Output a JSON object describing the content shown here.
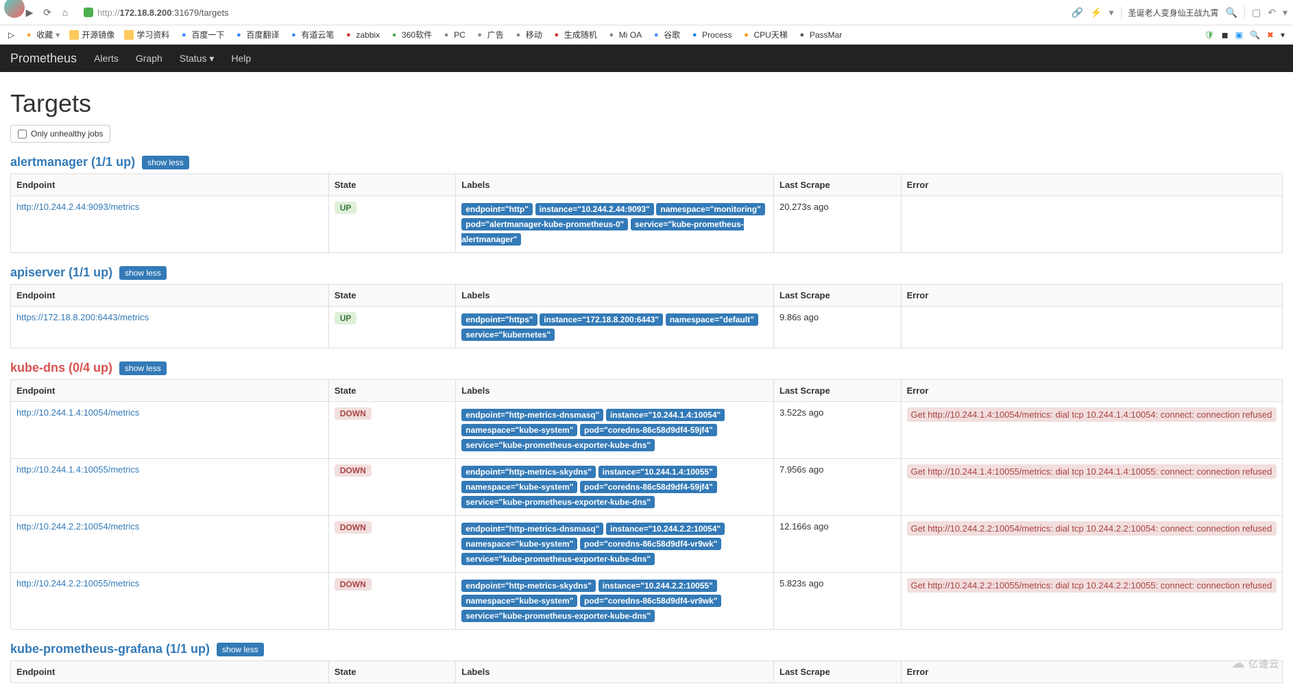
{
  "browser": {
    "url_prefix": "http://",
    "url_host": "172.18.8.200",
    "url_rest": ":31679/targets",
    "search_placeholder": "圣诞老人变身仙王战九霄"
  },
  "bookmarks": [
    {
      "icon": "star",
      "color": "#f5a623",
      "label": "收藏"
    },
    {
      "icon": "folder",
      "label": "开源镜像"
    },
    {
      "icon": "folder",
      "label": "学习资料"
    },
    {
      "icon": "paw",
      "color": "#3385ff",
      "label": "百度一下"
    },
    {
      "icon": "trans",
      "color": "#3385ff",
      "label": "百度翻译"
    },
    {
      "icon": "note",
      "color": "#3b8cff",
      "label": "有道云笔"
    },
    {
      "icon": "z",
      "color": "#d32f2f",
      "label": "zabbix"
    },
    {
      "icon": "360",
      "color": "#4caf50",
      "label": "360软件"
    },
    {
      "icon": "pc",
      "color": "#888",
      "label": "PC"
    },
    {
      "icon": "ad",
      "color": "#888",
      "label": "广告"
    },
    {
      "icon": "mob",
      "color": "#888",
      "label": "移动"
    },
    {
      "icon": "bug",
      "color": "#d32f2f",
      "label": "生成随机"
    },
    {
      "icon": "oa",
      "color": "#888",
      "label": "Mi OA"
    },
    {
      "icon": "g",
      "color": "#4285f4",
      "label": "谷歌"
    },
    {
      "icon": "on",
      "color": "#1e88e5",
      "label": "Process"
    },
    {
      "icon": "cpu",
      "color": "#ff9800",
      "label": "CPU天梯"
    },
    {
      "icon": "pass",
      "color": "#555",
      "label": "PassMar"
    }
  ],
  "nav": {
    "brand": "Prometheus",
    "items": [
      "Alerts",
      "Graph",
      "Status",
      "Help"
    ]
  },
  "page": {
    "title": "Targets",
    "filter_label": "Only unhealthy jobs",
    "show_less": "show less"
  },
  "table_headers": {
    "endpoint": "Endpoint",
    "state": "State",
    "labels": "Labels",
    "last_scrape": "Last Scrape",
    "error": "Error"
  },
  "jobs": [
    {
      "name": "alertmanager",
      "count": "(1/1 up)",
      "healthy": true,
      "rows": [
        {
          "endpoint": "http://10.244.2.44:9093/metrics",
          "state": "UP",
          "labels": [
            "endpoint=\"http\"",
            "instance=\"10.244.2.44:9093\"",
            "namespace=\"monitoring\"",
            "pod=\"alertmanager-kube-prometheus-0\"",
            "service=\"kube-prometheus-alertmanager\""
          ],
          "scrape": "20.273s ago",
          "error": ""
        }
      ]
    },
    {
      "name": "apiserver",
      "count": "(1/1 up)",
      "healthy": true,
      "rows": [
        {
          "endpoint": "https://172.18.8.200:6443/metrics",
          "state": "UP",
          "labels": [
            "endpoint=\"https\"",
            "instance=\"172.18.8.200:6443\"",
            "namespace=\"default\"",
            "service=\"kubernetes\""
          ],
          "scrape": "9.86s ago",
          "error": ""
        }
      ]
    },
    {
      "name": "kube-dns",
      "count": "(0/4 up)",
      "healthy": false,
      "rows": [
        {
          "endpoint": "http://10.244.1.4:10054/metrics",
          "state": "DOWN",
          "labels": [
            "endpoint=\"http-metrics-dnsmasq\"",
            "instance=\"10.244.1.4:10054\"",
            "namespace=\"kube-system\"",
            "pod=\"coredns-86c58d9df4-59jf4\"",
            "service=\"kube-prometheus-exporter-kube-dns\""
          ],
          "scrape": "3.522s ago",
          "error": "Get http://10.244.1.4:10054/metrics: dial tcp 10.244.1.4:10054: connect: connection refused"
        },
        {
          "endpoint": "http://10.244.1.4:10055/metrics",
          "state": "DOWN",
          "labels": [
            "endpoint=\"http-metrics-skydns\"",
            "instance=\"10.244.1.4:10055\"",
            "namespace=\"kube-system\"",
            "pod=\"coredns-86c58d9df4-59jf4\"",
            "service=\"kube-prometheus-exporter-kube-dns\""
          ],
          "scrape": "7.956s ago",
          "error": "Get http://10.244.1.4:10055/metrics: dial tcp 10.244.1.4:10055: connect: connection refused"
        },
        {
          "endpoint": "http://10.244.2.2:10054/metrics",
          "state": "DOWN",
          "labels": [
            "endpoint=\"http-metrics-dnsmasq\"",
            "instance=\"10.244.2.2:10054\"",
            "namespace=\"kube-system\"",
            "pod=\"coredns-86c58d9df4-vr9wk\"",
            "service=\"kube-prometheus-exporter-kube-dns\""
          ],
          "scrape": "12.166s ago",
          "error": "Get http://10.244.2.2:10054/metrics: dial tcp 10.244.2.2:10054: connect: connection refused"
        },
        {
          "endpoint": "http://10.244.2.2:10055/metrics",
          "state": "DOWN",
          "labels": [
            "endpoint=\"http-metrics-skydns\"",
            "instance=\"10.244.2.2:10055\"",
            "namespace=\"kube-system\"",
            "pod=\"coredns-86c58d9df4-vr9wk\"",
            "service=\"kube-prometheus-exporter-kube-dns\""
          ],
          "scrape": "5.823s ago",
          "error": "Get http://10.244.2.2:10055/metrics: dial tcp 10.244.2.2:10055: connect: connection refused"
        }
      ]
    },
    {
      "name": "kube-prometheus-grafana",
      "count": "(1/1 up)",
      "healthy": true,
      "rows": []
    }
  ],
  "watermark": "亿速云"
}
